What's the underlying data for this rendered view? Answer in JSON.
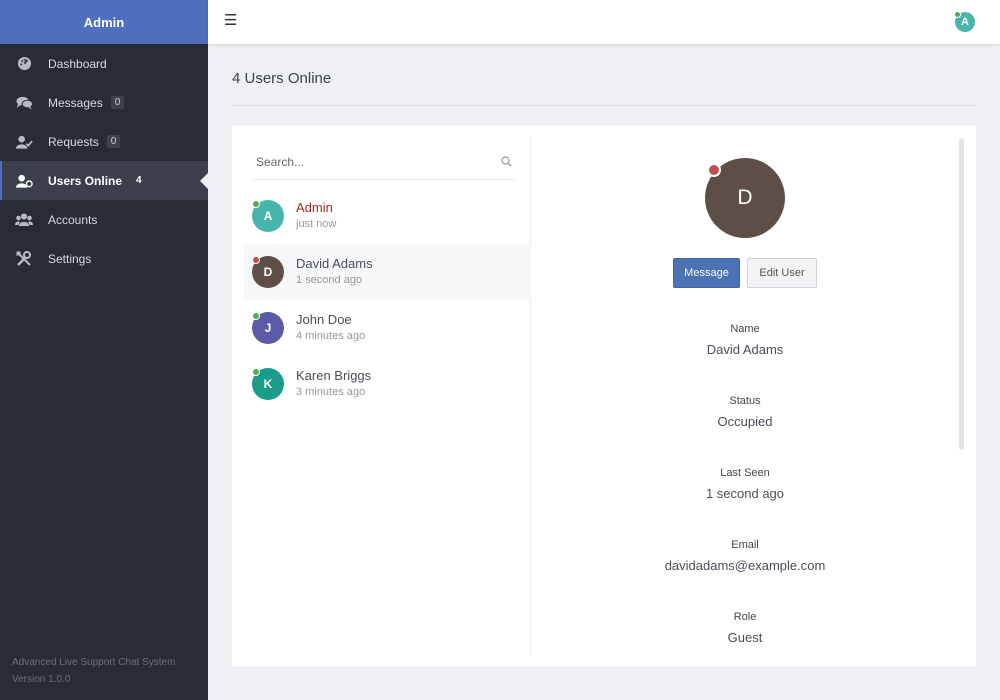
{
  "sidebar": {
    "title": "Admin",
    "items": [
      {
        "label": "Dashboard",
        "icon": "dashboard-icon",
        "badge": ""
      },
      {
        "label": "Messages",
        "icon": "messages-icon",
        "badge": "0"
      },
      {
        "label": "Requests",
        "icon": "requests-icon",
        "badge": "0"
      },
      {
        "label": "Users Online",
        "icon": "users-online-icon",
        "badge": "4"
      },
      {
        "label": "Accounts",
        "icon": "accounts-icon",
        "badge": ""
      },
      {
        "label": "Settings",
        "icon": "settings-icon",
        "badge": ""
      }
    ],
    "active_item": "Users Online",
    "footer": {
      "line1": "Advanced Live Support Chat System",
      "line2": "Version 1.0.0"
    }
  },
  "topbar": {
    "menu_icon": "hamburger-icon",
    "avatar_initial": "A"
  },
  "page": {
    "title": "4 Users Online"
  },
  "search": {
    "placeholder": "Search..."
  },
  "users": [
    {
      "initial": "A",
      "name": "Admin",
      "time": "just now",
      "color": "#48b5ad",
      "status_color": "#4caf50",
      "highlight": true
    },
    {
      "initial": "D",
      "name": "David Adams",
      "time": "1 second ago",
      "color": "#5d4f48",
      "status_color": "#c0504d",
      "selected": true
    },
    {
      "initial": "J",
      "name": "John Doe",
      "time": "4 minutes ago",
      "color": "#5a5aa6",
      "status_color": "#4caf50"
    },
    {
      "initial": "K",
      "name": "Karen Briggs",
      "time": "3 minutes ago",
      "color": "#1a9c88",
      "status_color": "#4caf50"
    }
  ],
  "detail": {
    "initial": "D",
    "avatar_color": "#5d4f48",
    "status_color": "#c0504d",
    "message_button": "Message",
    "edit_button": "Edit User",
    "fields": [
      {
        "label": "Name",
        "value": "David Adams"
      },
      {
        "label": "Status",
        "value": "Occupied"
      },
      {
        "label": "Last Seen",
        "value": "1 second ago"
      },
      {
        "label": "Email",
        "value": "davidadams@example.com"
      },
      {
        "label": "Role",
        "value": "Guest"
      }
    ]
  },
  "colors": {
    "sidebar_bg": "#282c36",
    "sidebar_header": "#4f6fbe",
    "accent": "#4a72b4",
    "highlight_name": "#a52a2a"
  }
}
